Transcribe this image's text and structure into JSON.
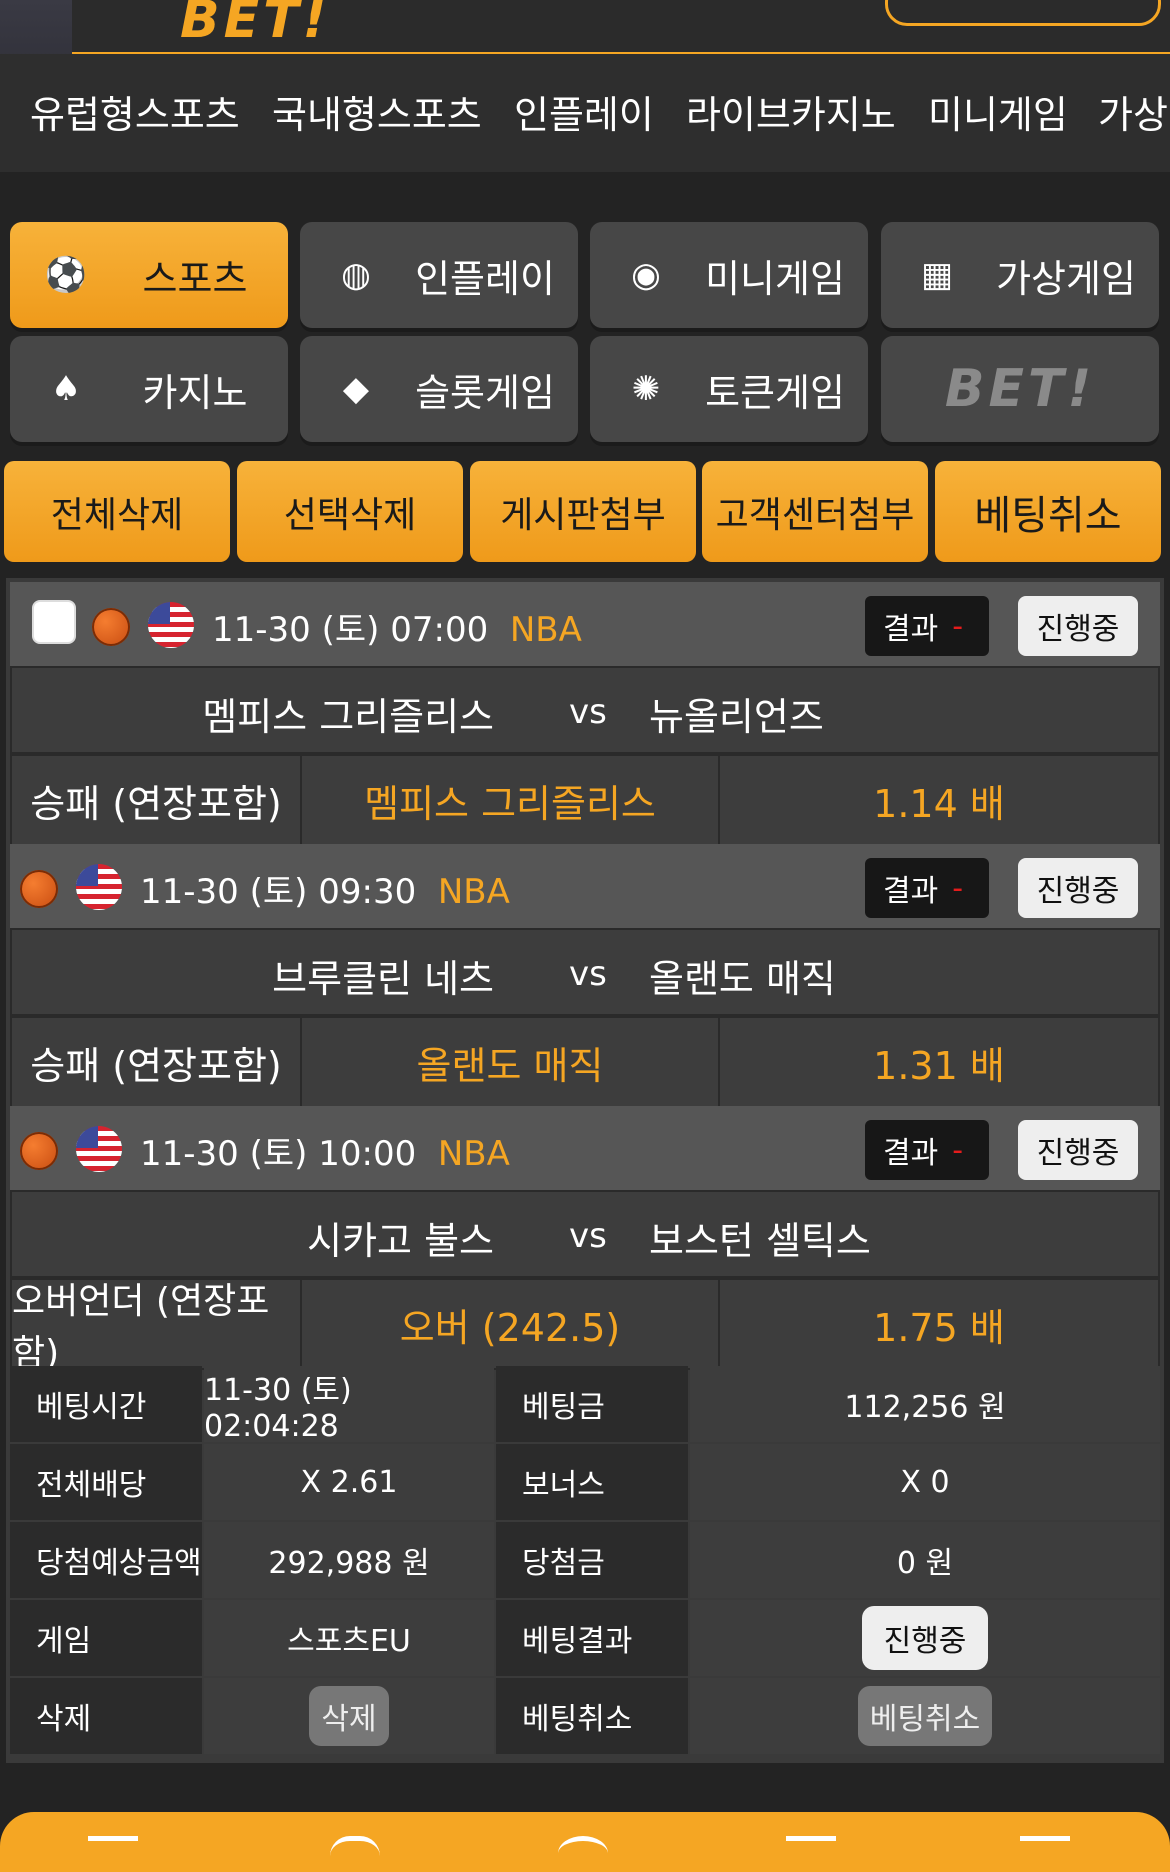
{
  "nav": {
    "items": [
      "유럽형스포츠",
      "국내형스포츠",
      "인플레이",
      "라이브카지노",
      "미니게임",
      "가상"
    ]
  },
  "categories": [
    {
      "label": "스포츠",
      "icon": "soccer-ball-icon",
      "active": true
    },
    {
      "label": "인플레이",
      "icon": "volleyball-icon",
      "active": false
    },
    {
      "label": "미니게임",
      "icon": "token-icon",
      "active": false
    },
    {
      "label": "가상게임",
      "icon": "slot-machine-icon",
      "active": false
    },
    {
      "label": "카지노",
      "icon": "cards-icon",
      "active": false
    },
    {
      "label": "슬롯게임",
      "icon": "football-icon",
      "active": false
    },
    {
      "label": "토큰게임",
      "icon": "chip-icon",
      "active": false
    },
    {
      "label": "BET!",
      "icon": "bet-logo",
      "active": false
    }
  ],
  "actions": [
    "전체삭제",
    "선택삭제",
    "게시판첨부",
    "고객센터첨부",
    "베팅취소"
  ],
  "bets": [
    {
      "date": "11-30 (토) 07:00",
      "league": "NBA",
      "result_label": "결과",
      "result_value": "-",
      "status": "진행중",
      "home": "멤피스 그리즐리스",
      "vs": "vs",
      "away": "뉴올리언즈",
      "market": "승패 (연장포함)",
      "pick": "멤피스 그리즐리스",
      "odds": "1.14 배"
    },
    {
      "date": "11-30 (토) 09:30",
      "league": "NBA",
      "result_label": "결과",
      "result_value": "-",
      "status": "진행중",
      "home": "브루클린 네츠",
      "vs": "vs",
      "away": "올랜도 매직",
      "market": "승패 (연장포함)",
      "pick": "올랜도 매직",
      "odds": "1.31 배"
    },
    {
      "date": "11-30 (토) 10:00",
      "league": "NBA",
      "result_label": "결과",
      "result_value": "-",
      "status": "진행중",
      "home": "시카고 불스",
      "vs": "vs",
      "away": "보스턴 셀틱스",
      "market": "오버언더 (연장포함)",
      "pick": "오버 (242.5)",
      "odds": "1.75 배"
    }
  ],
  "summary": {
    "bet_time_label": "베팅시간",
    "bet_time": "11-30 (토) 02:04:28",
    "bet_amount_label": "베팅금",
    "bet_amount": "112,256 원",
    "total_odds_label": "전체배당",
    "total_odds": "X 2.61",
    "bonus_label": "보너스",
    "bonus": "X 0",
    "expected_label": "당첨예상금액",
    "expected": "292,988 원",
    "win_label": "당첨금",
    "win": "0 원",
    "game_label": "게임",
    "game": "스포츠EU",
    "result_label": "베팅결과",
    "result": "진행중",
    "delete_label": "삭제",
    "delete_btn": "삭제",
    "cancel_label": "베팅취소",
    "cancel_btn": "베팅취소"
  },
  "colors": {
    "accent": "#f5a623",
    "background": "#232323",
    "panel": "#3d3d3d"
  }
}
